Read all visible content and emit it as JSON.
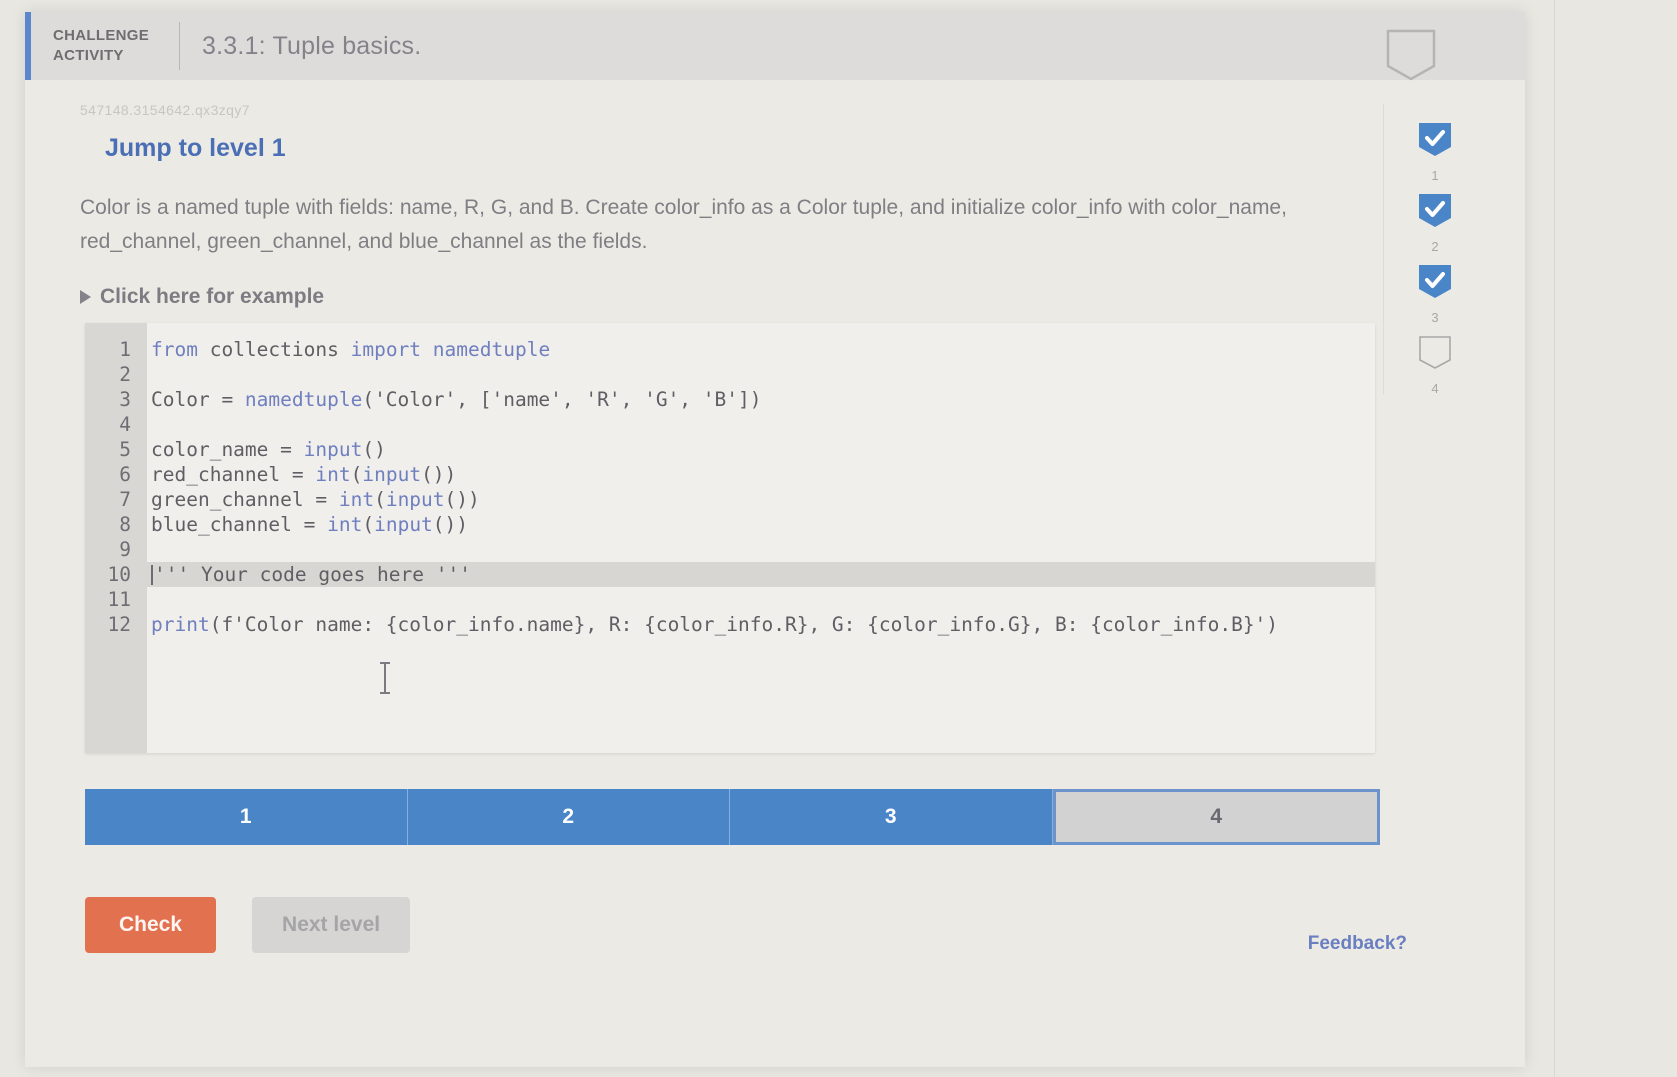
{
  "header": {
    "kicker": "CHALLENGE\nACTIVITY",
    "kicker_line1": "CHALLENGE",
    "kicker_line2": "ACTIVITY",
    "title": "3.3.1: Tuple basics.",
    "badge_icon": "empty-pennant-icon",
    "accent_color": "#5c86cc"
  },
  "activity": {
    "id": "547148.3154642.qx3zqy7",
    "jump_to_level": "Jump to level 1",
    "prompt": "Color is a named tuple with fields: name, R, G, and B. Create color_info as a Color tuple, and initialize color_info with color_name, red_channel, green_channel, and blue_channel as the fields.",
    "example_toggle": "Click here for example"
  },
  "editor": {
    "lines": [
      {
        "num": "1",
        "text": "from collections import namedtuple",
        "active": false
      },
      {
        "num": "2",
        "text": "",
        "active": false
      },
      {
        "num": "3",
        "text": "Color = namedtuple('Color', ['name', 'R', 'G', 'B'])",
        "active": false
      },
      {
        "num": "4",
        "text": "",
        "active": false
      },
      {
        "num": "5",
        "text": "color_name = input()",
        "active": false
      },
      {
        "num": "6",
        "text": "red_channel = int(input())",
        "active": false
      },
      {
        "num": "7",
        "text": "green_channel = int(input())",
        "active": false
      },
      {
        "num": "8",
        "text": "blue_channel = int(input())",
        "active": false
      },
      {
        "num": "9",
        "text": "",
        "active": false
      },
      {
        "num": "10",
        "text": "''' Your code goes here '''",
        "active": true
      },
      {
        "num": "11",
        "text": "",
        "active": false
      },
      {
        "num": "12",
        "text": "print(f'Color name: {color_info.name}, R: {color_info.R}, G: {color_info.G}, B: {color_info.B}')",
        "active": false
      }
    ]
  },
  "progress": {
    "segments": [
      {
        "label": "1",
        "state": "done"
      },
      {
        "label": "2",
        "state": "done"
      },
      {
        "label": "3",
        "state": "done"
      },
      {
        "label": "4",
        "state": "current"
      }
    ],
    "done_color": "#4a85c8",
    "current_color": "#d2d2d2"
  },
  "buttons": {
    "check": "Check",
    "next_level": "Next level",
    "check_color": "#e2714f"
  },
  "rail": {
    "items": [
      {
        "num": "1",
        "state": "complete"
      },
      {
        "num": "2",
        "state": "complete"
      },
      {
        "num": "3",
        "state": "complete"
      },
      {
        "num": "4",
        "state": "empty"
      }
    ]
  },
  "footer": {
    "feedback": "Feedback?"
  }
}
